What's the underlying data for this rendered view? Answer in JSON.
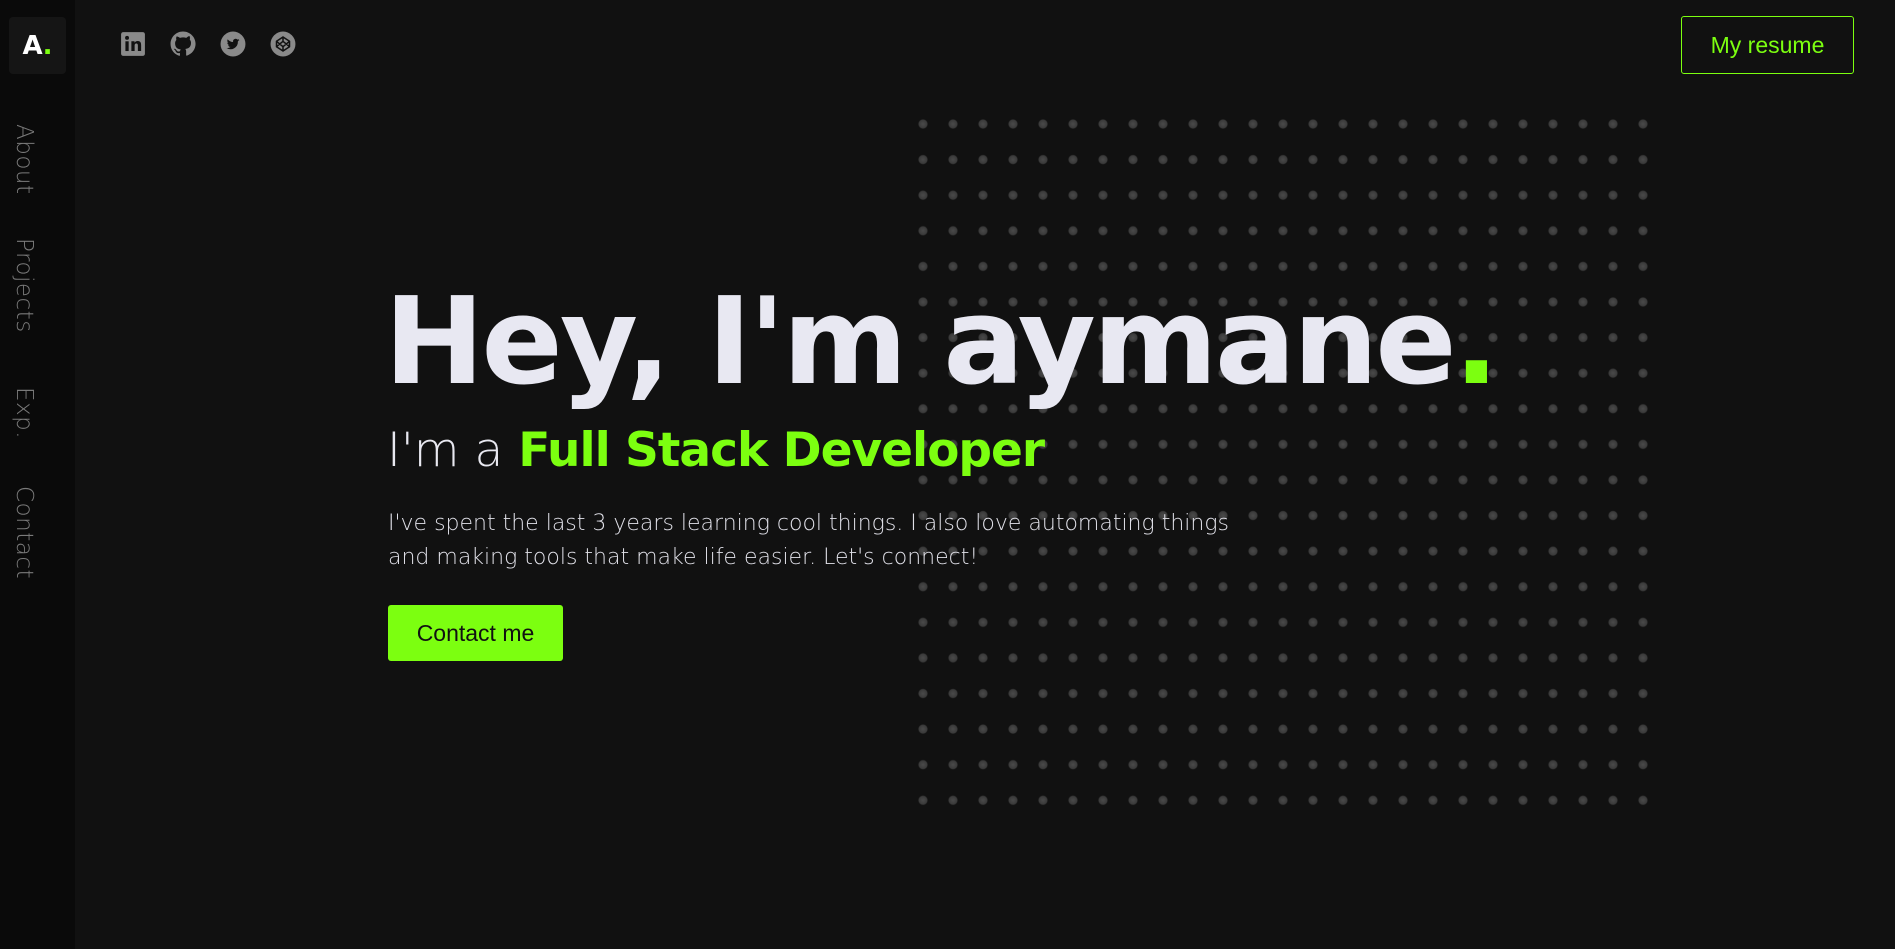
{
  "logo": {
    "letter": "A",
    "dot": "."
  },
  "nav": {
    "items": [
      {
        "label": "About"
      },
      {
        "label": "Projects"
      },
      {
        "label": "Exp."
      },
      {
        "label": "Contact"
      }
    ]
  },
  "socials": [
    {
      "icon": "linkedin-icon"
    },
    {
      "icon": "github-icon"
    },
    {
      "icon": "twitter-icon"
    },
    {
      "icon": "codepen-icon"
    }
  ],
  "header": {
    "resume_label": "My resume"
  },
  "hero": {
    "title": "Hey, I'm aymane",
    "title_dot": ".",
    "subtitle_lead": "I'm a ",
    "subtitle_role": "Full Stack Developer",
    "bio": "I've spent the last 3 years learning cool things. I also love automating things and making tools that make life easier. Let's connect!",
    "cta_label": "Contact me"
  },
  "colors": {
    "accent": "#7cff10",
    "background": "#111111",
    "sidebar": "#0a0a0a",
    "text": "#e8e8f0",
    "muted": "#7a7a7a"
  }
}
